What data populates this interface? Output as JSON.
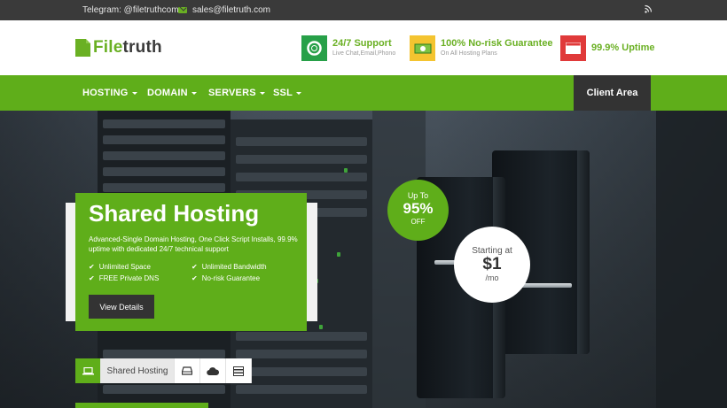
{
  "topbar": {
    "telegram": "Telegram: @filetruthcom",
    "email": "sales@filetruth.com"
  },
  "logo": {
    "part1": "File",
    "part2": "truth"
  },
  "features": [
    {
      "title": "24/7 Support",
      "subtitle": "Live Chat,Email,Phono",
      "icon": "lifebuoy-icon",
      "color": "#27a048"
    },
    {
      "title": "100% No-risk Guarantee",
      "subtitle": "On All Hosting Plans",
      "icon": "money-icon",
      "color": "#f4c430"
    },
    {
      "title": "99.9% Uptime",
      "subtitle": "",
      "icon": "browser-window-icon",
      "color": "#e03a3a"
    }
  ],
  "nav": {
    "items": [
      "HOSTING",
      "DOMAIN",
      "SERVERS",
      "SSL"
    ],
    "client_area": "Client Area"
  },
  "hero": {
    "title": "Shared Hosting",
    "description": "Advanced-Single Domain Hosting, One Click Script Installs, 99.9% uptime with dedicated 24/7 technical support",
    "checks": [
      "Unlimited Space",
      "Unlimited Bandwidth",
      "FREE Private DNS",
      "No-risk Guarantee"
    ],
    "button": "View Details",
    "badge_discount": {
      "top": "Up To",
      "value": "95%",
      "bottom": "OFF"
    },
    "badge_price": {
      "top": "Starting at",
      "value": "$1",
      "bottom": "/mo"
    }
  },
  "tabs": {
    "active_label": "Shared Hosting",
    "icons": [
      "laptop-icon",
      "server-drive-icon",
      "cloud-icon",
      "server-rack-icon"
    ]
  },
  "colors": {
    "brand_green": "#5fae1a",
    "dark": "#333333"
  }
}
